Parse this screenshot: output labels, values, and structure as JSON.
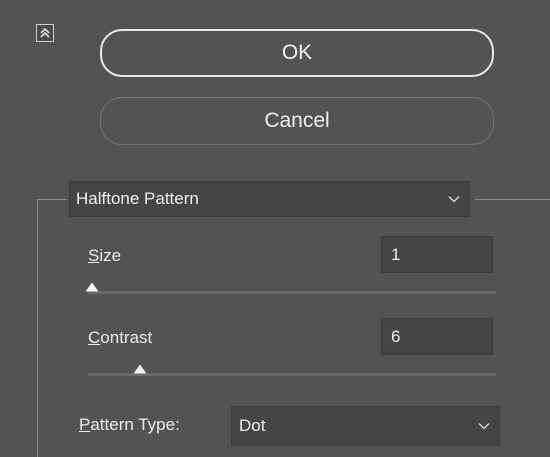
{
  "buttons": {
    "ok_label": "OK",
    "cancel_label": "Cancel"
  },
  "filter": {
    "selected": "Halftone Pattern"
  },
  "size": {
    "label_underlined": "S",
    "label_rest": "ize",
    "value": "1",
    "min": 1,
    "max": 12,
    "slider_value": 1
  },
  "contrast": {
    "label_underlined": "C",
    "label_rest": "ontrast",
    "value": "6",
    "min": 0,
    "max": 50,
    "slider_value": 6
  },
  "pattern_type": {
    "label_underlined": "P",
    "label_rest": "attern Type:",
    "selected": "Dot"
  },
  "icons": {
    "collapse": "double-chevron-up-icon",
    "dropdown": "chevron-down-icon"
  },
  "colors": {
    "panel_bg": "#535353",
    "field_bg": "#454545",
    "text": "#f0f0f0"
  }
}
